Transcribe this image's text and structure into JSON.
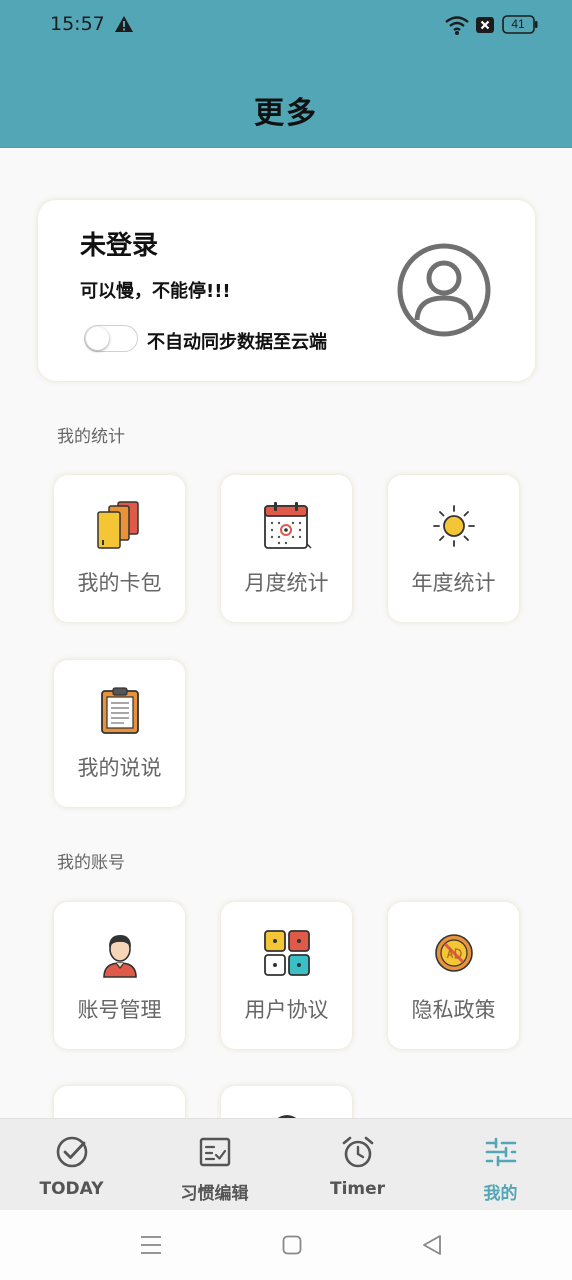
{
  "status_bar": {
    "time": "15:57",
    "battery": "41"
  },
  "header": {
    "title": "更多"
  },
  "profile": {
    "title": "未登录",
    "motto": "可以慢，不能停!!!",
    "sync_label": "不自动同步数据至云端",
    "sync_enabled": false
  },
  "sections": {
    "stats": {
      "label": "我的统计",
      "items": [
        {
          "label": "我的卡包",
          "icon": "cards-icon"
        },
        {
          "label": "月度统计",
          "icon": "calendar-icon"
        },
        {
          "label": "年度统计",
          "icon": "sun-icon"
        },
        {
          "label": "我的说说",
          "icon": "clipboard-icon"
        }
      ]
    },
    "account": {
      "label": "我的账号",
      "items": [
        {
          "label": "账号管理",
          "icon": "user-icon"
        },
        {
          "label": "用户协议",
          "icon": "grid-icon"
        },
        {
          "label": "隐私政策",
          "icon": "no-ad-icon"
        }
      ]
    }
  },
  "tabbar": {
    "tabs": [
      {
        "label": "TODAY",
        "icon": "check-circle-icon",
        "active": false
      },
      {
        "label": "习惯编辑",
        "icon": "edit-list-icon",
        "active": false
      },
      {
        "label": "Timer",
        "icon": "alarm-clock-icon",
        "active": false
      },
      {
        "label": "我的",
        "icon": "sliders-icon",
        "active": true
      }
    ]
  },
  "colors": {
    "header": "#53a6b6",
    "accent": "#53a6b6",
    "background": "#f9f9f9"
  }
}
